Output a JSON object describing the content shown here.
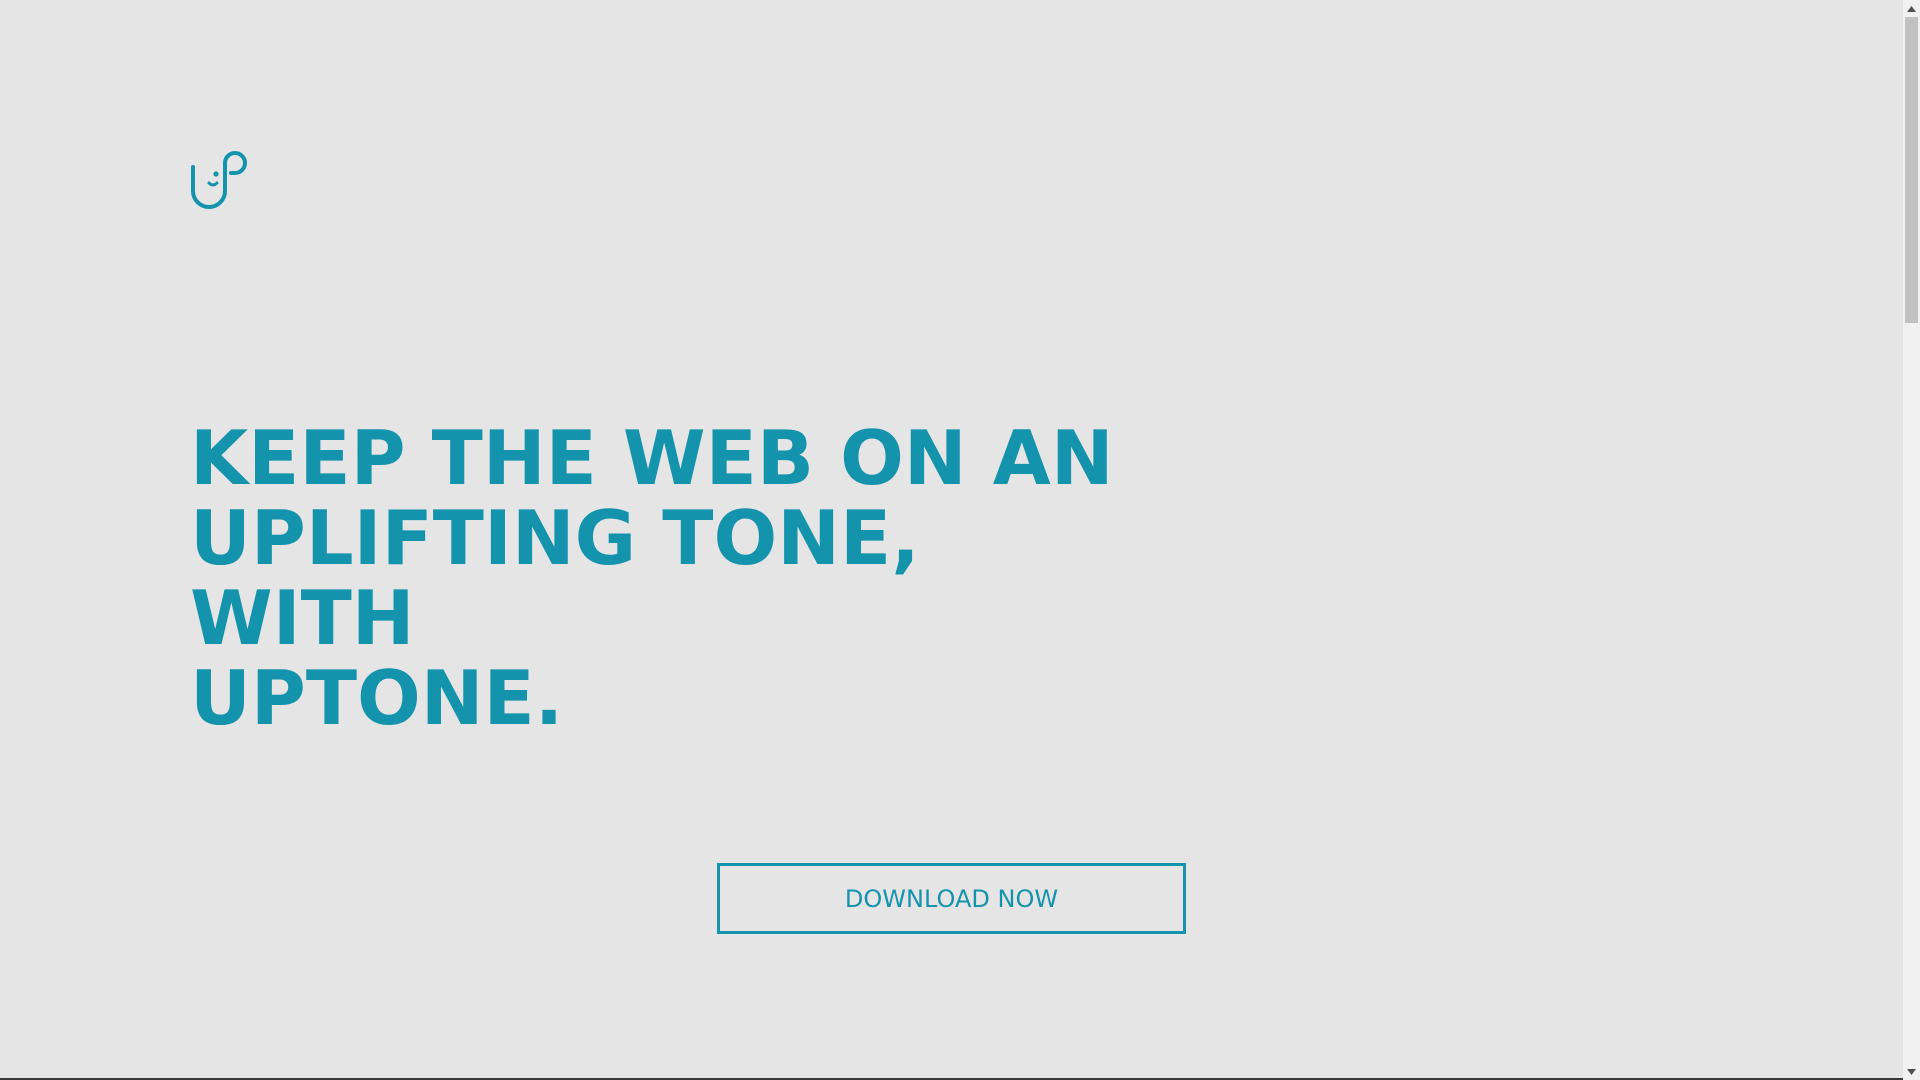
{
  "brand": {
    "logo_icon": "uptone-logo-icon",
    "accent_color": "#1493ad",
    "background_color": "#e5e5e5"
  },
  "hero": {
    "headline_lines": [
      "KEEP THE WEB ON AN",
      "UPLIFTING TONE, WITH",
      "UPTONE."
    ]
  },
  "cta": {
    "download_label": "DOWNLOAD NOW"
  },
  "scrollbar": {
    "up_icon": "scroll-up-arrow-icon",
    "down_icon": "scroll-down-arrow-icon"
  }
}
